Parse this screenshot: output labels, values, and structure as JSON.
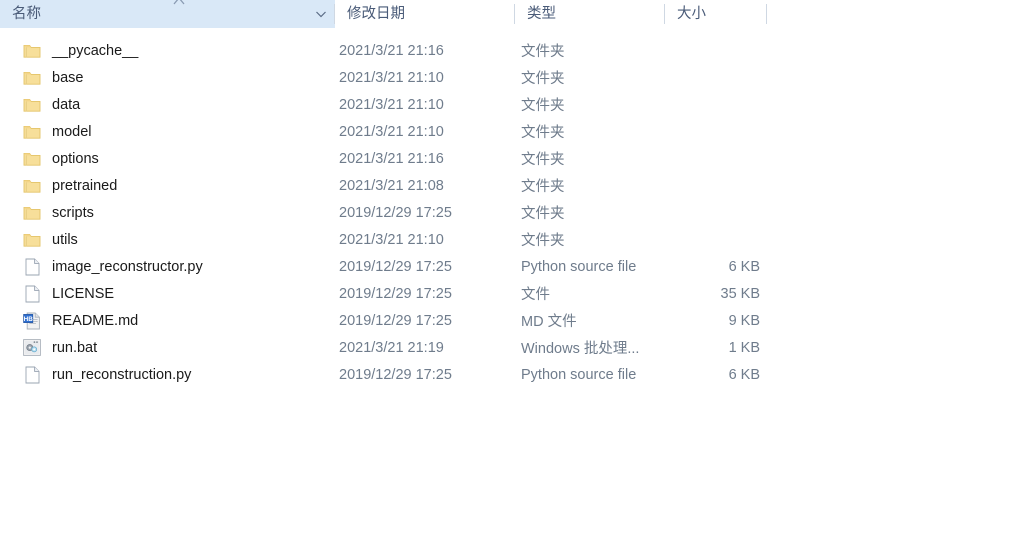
{
  "window": {
    "view": "details-list"
  },
  "columns": {
    "name": {
      "label": "名称",
      "sorted": true,
      "sort_direction": "ascending"
    },
    "date": {
      "label": "修改日期"
    },
    "type": {
      "label": "类型"
    },
    "size": {
      "label": "大小"
    }
  },
  "icons": {
    "sort_ascending": "caret-up-icon",
    "header_menu": "chevron-down-icon",
    "folder": "folder-icon",
    "generic_file": "blank-document-icon",
    "markdown_file": "md-document-icon",
    "batch_file": "batch-gears-icon"
  },
  "colors": {
    "header_sorted_bg": "#d9e8f7",
    "header_text": "#4a5b78",
    "row_text": "#1a1a1a",
    "meta_text": "#6f7c8c",
    "folder_fill": "#f7df9a",
    "folder_stroke": "#e7c86a",
    "md_badge": "#2f6fd0"
  },
  "rows": [
    {
      "name": "__pycache__",
      "icon": "folder",
      "date": "2021/3/21 21:16",
      "type": "文件夹",
      "size": ""
    },
    {
      "name": "base",
      "icon": "folder",
      "date": "2021/3/21 21:10",
      "type": "文件夹",
      "size": ""
    },
    {
      "name": "data",
      "icon": "folder",
      "date": "2021/3/21 21:10",
      "type": "文件夹",
      "size": ""
    },
    {
      "name": "model",
      "icon": "folder",
      "date": "2021/3/21 21:10",
      "type": "文件夹",
      "size": ""
    },
    {
      "name": "options",
      "icon": "folder",
      "date": "2021/3/21 21:16",
      "type": "文件夹",
      "size": ""
    },
    {
      "name": "pretrained",
      "icon": "folder",
      "date": "2021/3/21 21:08",
      "type": "文件夹",
      "size": ""
    },
    {
      "name": "scripts",
      "icon": "folder",
      "date": "2019/12/29 17:25",
      "type": "文件夹",
      "size": ""
    },
    {
      "name": "utils",
      "icon": "folder",
      "date": "2021/3/21 21:10",
      "type": "文件夹",
      "size": ""
    },
    {
      "name": "image_reconstructor.py",
      "icon": "generic_file",
      "date": "2019/12/29 17:25",
      "type": "Python source file",
      "size": "6 KB"
    },
    {
      "name": "LICENSE",
      "icon": "generic_file",
      "date": "2019/12/29 17:25",
      "type": "文件",
      "size": "35 KB"
    },
    {
      "name": "README.md",
      "icon": "markdown_file",
      "date": "2019/12/29 17:25",
      "type": "MD 文件",
      "size": "9 KB"
    },
    {
      "name": "run.bat",
      "icon": "batch_file",
      "date": "2021/3/21 21:19",
      "type": "Windows 批处理...",
      "size": "1 KB"
    },
    {
      "name": "run_reconstruction.py",
      "icon": "generic_file",
      "date": "2019/12/29 17:25",
      "type": "Python source file",
      "size": "6 KB"
    }
  ]
}
